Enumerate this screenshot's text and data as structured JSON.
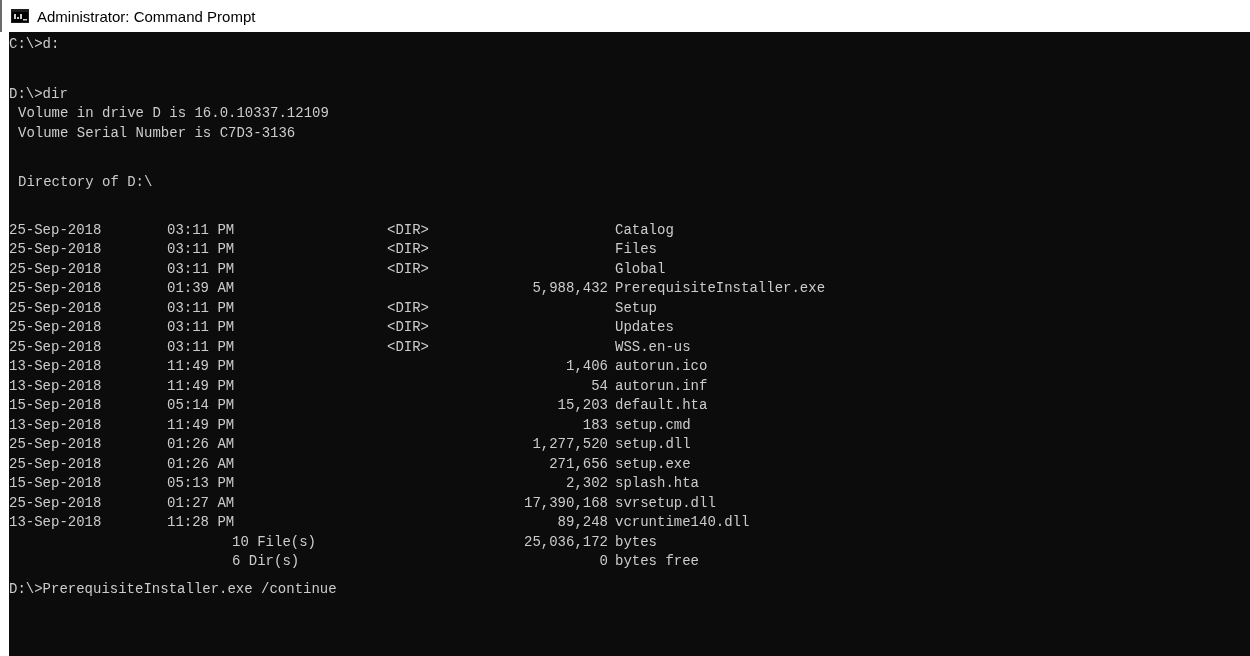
{
  "window": {
    "title": "Administrator: Command Prompt"
  },
  "console": {
    "first_command": "C:\\>d:",
    "second_command": "D:\\>dir",
    "volume_info": [
      "Volume in drive D is 16.0.10337.12109",
      "Volume Serial Number is C7D3-3136"
    ],
    "directory_heading": "Directory of D:\\",
    "entries": [
      {
        "kind": "dir",
        "date": "25-Sep-2018",
        "time": "03:11 PM",
        "tag": "<DIR>",
        "name": "Catalog"
      },
      {
        "kind": "dir",
        "date": "25-Sep-2018",
        "time": "03:11 PM",
        "tag": "<DIR>",
        "name": "Files"
      },
      {
        "kind": "dir",
        "date": "25-Sep-2018",
        "time": "03:11 PM",
        "tag": "<DIR>",
        "name": "Global"
      },
      {
        "kind": "file",
        "date": "25-Sep-2018",
        "time": "01:39 AM",
        "size": "5,988,432",
        "name": "PrerequisiteInstaller.exe"
      },
      {
        "kind": "dir",
        "date": "25-Sep-2018",
        "time": "03:11 PM",
        "tag": "<DIR>",
        "name": "Setup"
      },
      {
        "kind": "dir",
        "date": "25-Sep-2018",
        "time": "03:11 PM",
        "tag": "<DIR>",
        "name": "Updates"
      },
      {
        "kind": "dir",
        "date": "25-Sep-2018",
        "time": "03:11 PM",
        "tag": "<DIR>",
        "name": "WSS.en-us"
      },
      {
        "kind": "file",
        "date": "13-Sep-2018",
        "time": "11:49 PM",
        "size": "1,406",
        "name": "autorun.ico"
      },
      {
        "kind": "file",
        "date": "13-Sep-2018",
        "time": "11:49 PM",
        "size": "54",
        "name": "autorun.inf"
      },
      {
        "kind": "file",
        "date": "15-Sep-2018",
        "time": "05:14 PM",
        "size": "15,203",
        "name": "default.hta"
      },
      {
        "kind": "file",
        "date": "13-Sep-2018",
        "time": "11:49 PM",
        "size": "183",
        "name": "setup.cmd"
      },
      {
        "kind": "file",
        "date": "25-Sep-2018",
        "time": "01:26 AM",
        "size": "1,277,520",
        "name": "setup.dll"
      },
      {
        "kind": "file",
        "date": "25-Sep-2018",
        "time": "01:26 AM",
        "size": "271,656",
        "name": "setup.exe"
      },
      {
        "kind": "file",
        "date": "15-Sep-2018",
        "time": "05:13 PM",
        "size": "2,302",
        "name": "splash.hta"
      },
      {
        "kind": "file",
        "date": "25-Sep-2018",
        "time": "01:27 AM",
        "size": "17,390,168",
        "name": "svrsetup.dll"
      },
      {
        "kind": "file",
        "date": "13-Sep-2018",
        "time": "11:28 PM",
        "size": "89,248",
        "name": "vcruntime140.dll"
      }
    ],
    "summary": [
      {
        "count": "10 File(s)",
        "size": "25,036,172",
        "unit": "bytes"
      },
      {
        "count": "6 Dir(s)",
        "size": "0",
        "unit": "bytes free"
      }
    ],
    "last_command": "D:\\>PrerequisiteInstaller.exe /continue"
  }
}
